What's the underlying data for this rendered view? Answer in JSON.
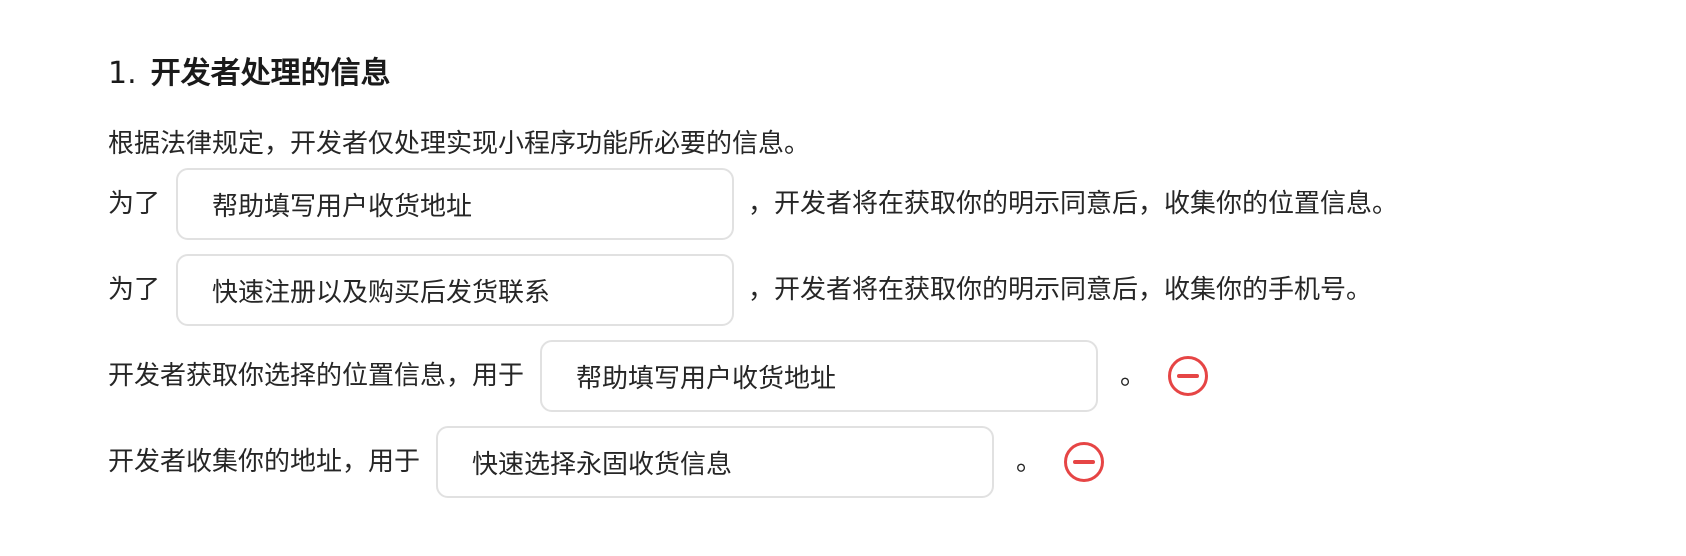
{
  "section": {
    "number": "1.",
    "title": "开发者处理的信息",
    "description": "根据法律规定，开发者仅处理实现小程序功能所必要的信息。"
  },
  "rows": [
    {
      "prefix": "为了",
      "purpose": "帮助填写用户收货地址",
      "suffix": "，开发者将在获取你的明示同意后，收集你的位置信息。"
    },
    {
      "prefix": "为了",
      "purpose": "快速注册以及购买后发货联系",
      "suffix": "，开发者将在获取你的明示同意后，收集你的手机号。"
    },
    {
      "prefix": "开发者获取你选择的位置信息，用于",
      "purpose": "帮助填写用户收货地址",
      "suffix": "。",
      "removable": true
    },
    {
      "prefix": "开发者收集你的地址，用于",
      "purpose": "快速选择永固收货信息",
      "suffix": "。",
      "removable": true
    }
  ],
  "colors": {
    "remove_icon": "#e64545",
    "field_border": "#e1e1e1"
  }
}
